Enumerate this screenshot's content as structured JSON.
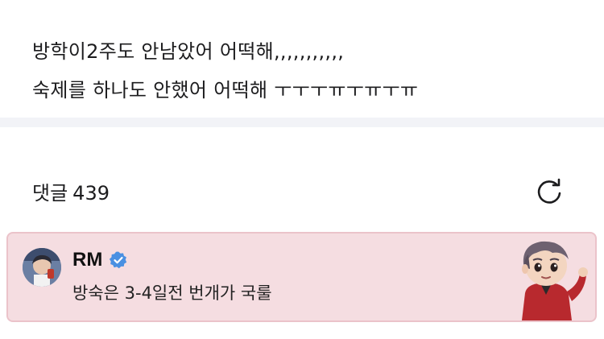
{
  "post": {
    "line1": "방학이2주도 안남았어 어떡해,,,,,,,,,,,",
    "line2": "숙제를 하나도 안했어 어떡해 ㅜㅜㅜㅠㅜㅠㅜㅠ"
  },
  "comments": {
    "label": "댓글",
    "count": "439",
    "refresh_icon": "refresh-icon"
  },
  "highlight_comment": {
    "author": "RM",
    "verified_icon": "verified-badge-icon",
    "text": "방숙은 3-4일전 번개가 국룰",
    "background": "#f5dde1",
    "border": "#ebc3ca",
    "badge_color": "#4a90e2"
  }
}
